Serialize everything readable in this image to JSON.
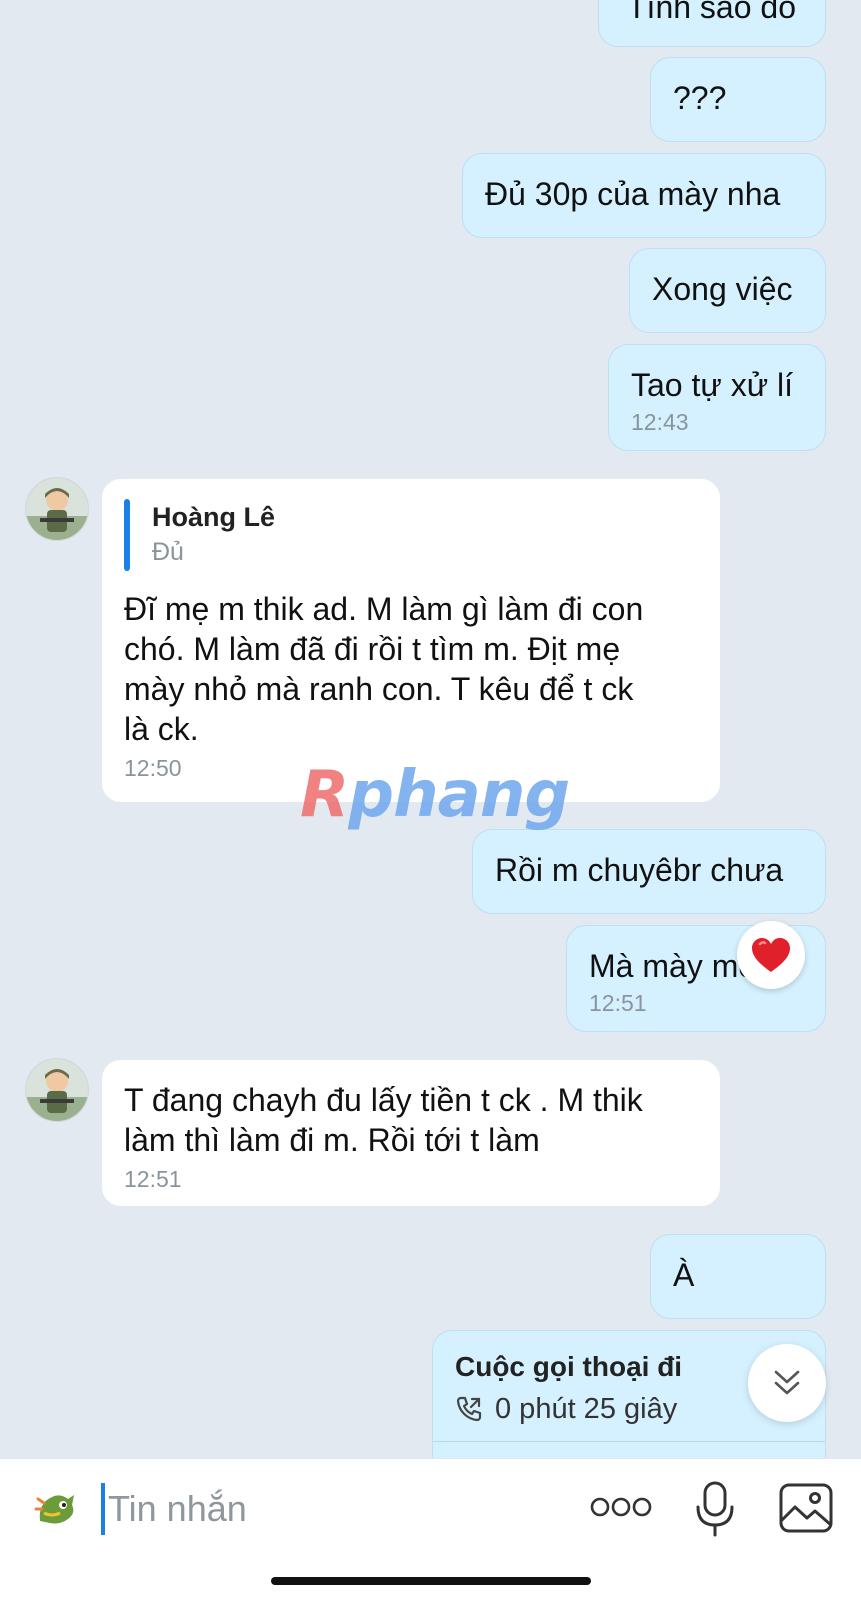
{
  "messages": [
    {
      "from": "me",
      "text": "Tính sao đó"
    },
    {
      "from": "me",
      "text": "???"
    },
    {
      "from": "me",
      "text": "Đủ 30p của mày nha"
    },
    {
      "from": "me",
      "text": "Xong việc"
    },
    {
      "from": "me",
      "text": "Tao tự xử lí",
      "time": "12:43"
    },
    {
      "from": "them",
      "quote": {
        "name": "Hoàng Lê",
        "text": "Đủ"
      },
      "lines": [
        "Đĩ mẹ m thik ad. M làm gì làm đi con",
        "chó. M làm đã đi rồi t tìm m. Địt mẹ",
        "mày nhỏ mà ranh con. T kêu để t ck",
        "là ck."
      ],
      "time": "12:50"
    },
    {
      "from": "me",
      "text": "Rồi m chuyêbr chưa"
    },
    {
      "from": "me",
      "text": "Mà mày mòm",
      "time": "12:51",
      "reaction": "heart"
    },
    {
      "from": "them",
      "lines": [
        "T đang chayh đu lấy tiền t ck . M thik",
        "làm thì làm đi m. Rồi tới t làm"
      ],
      "time": "12:51"
    },
    {
      "from": "me",
      "text": "À"
    },
    {
      "from": "me",
      "call": {
        "title": "Cuộc gọi thoại đi",
        "duration": "0 phút 25 giây"
      }
    }
  ],
  "watermark": {
    "first": "R",
    "rest": "phang"
  },
  "composer": {
    "placeholder": "Tin nhắn"
  },
  "colors": {
    "me_bubble": "#d5f1ff",
    "them_bubble": "#ffffff",
    "background": "#e2e9f1",
    "accent": "#1a7fe6"
  },
  "icons": [
    "heart-icon",
    "chevron-double-down-icon",
    "sticker-icon",
    "more-dots-icon",
    "microphone-icon",
    "image-icon",
    "phone-outgoing-icon"
  ]
}
